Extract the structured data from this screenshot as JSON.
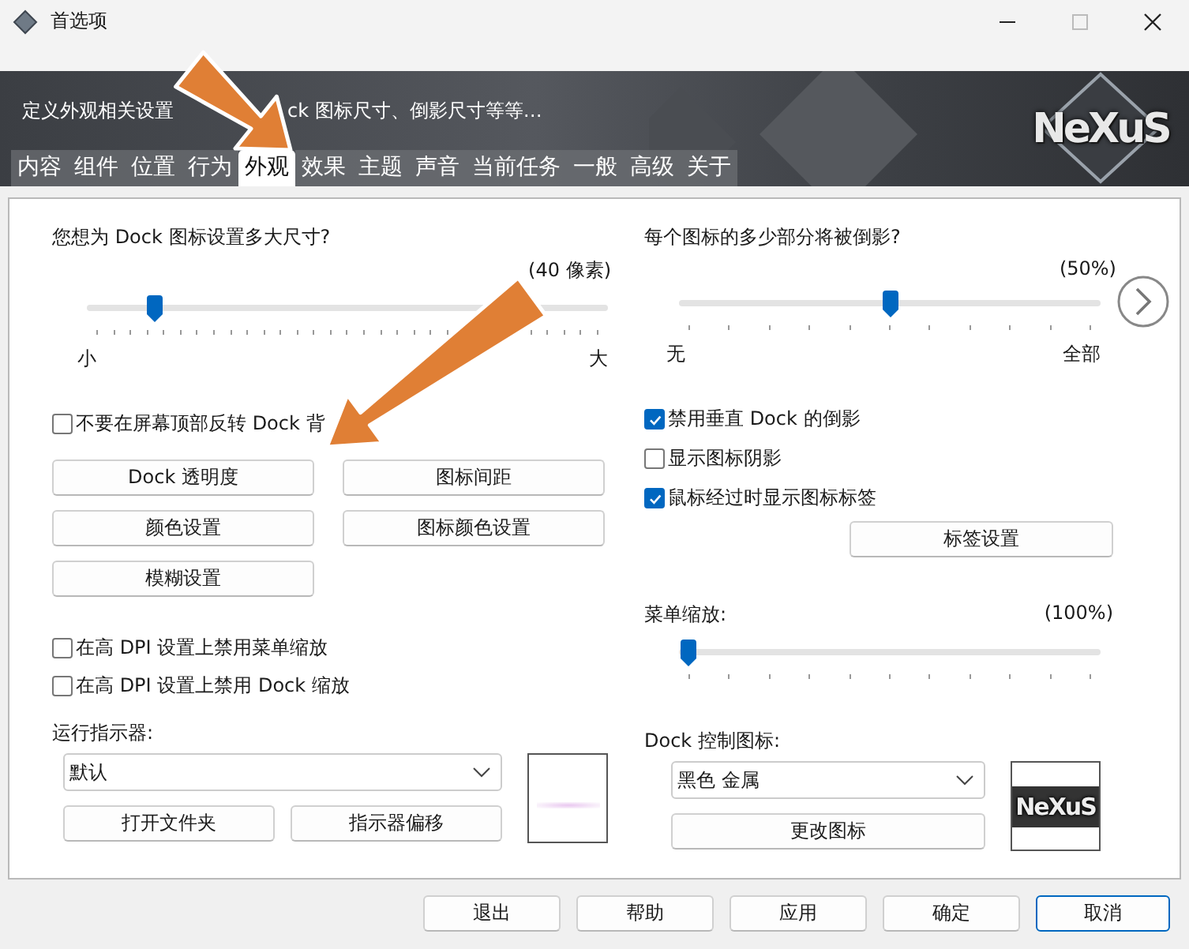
{
  "window": {
    "title": "首选项"
  },
  "header": {
    "description_parts": [
      "定义外观相关设置",
      "ck 图标尺寸、倒影尺寸等等…"
    ],
    "logo": "NeXuS"
  },
  "tabs": [
    {
      "label": "内容",
      "selected": false
    },
    {
      "label": "组件",
      "selected": false
    },
    {
      "label": "位置",
      "selected": false
    },
    {
      "label": "行为",
      "selected": false
    },
    {
      "label": "外观",
      "selected": true
    },
    {
      "label": "效果",
      "selected": false
    },
    {
      "label": "主题",
      "selected": false
    },
    {
      "label": "声音",
      "selected": false
    },
    {
      "label": "当前任务",
      "selected": false
    },
    {
      "label": "一般",
      "selected": false
    },
    {
      "label": "高级",
      "selected": false
    },
    {
      "label": "关于",
      "selected": false
    }
  ],
  "size": {
    "question": "您想为 Dock 图标设置多大尺寸?",
    "reading": "(40 像素)",
    "level": 0.115,
    "min_label": "小",
    "max_label": "大"
  },
  "flip_checkbox": {
    "label": "不要在屏幕顶部反转 Dock 背",
    "checked": false
  },
  "left_buttons": [
    "Dock 透明度",
    "图标间距",
    "颜色设置",
    "图标颜色设置",
    "模糊设置"
  ],
  "dpi_checkboxes": [
    {
      "label": "在高 DPI 设置上禁用菜单缩放",
      "checked": false
    },
    {
      "label": "在高 DPI 设置上禁用 Dock 缩放",
      "checked": false
    }
  ],
  "indicator": {
    "label": "运行指示器:",
    "value": "默认",
    "buttons": [
      "打开文件夹",
      "指示器偏移"
    ]
  },
  "reflection": {
    "question": "每个图标的多少部分将被倒影?",
    "reading": "(50%)",
    "level": 0.5,
    "min_label": "无",
    "max_label": "全部"
  },
  "right_checkboxes": [
    {
      "label": "禁用垂直 Dock 的倒影",
      "checked": true
    },
    {
      "label": "显示图标阴影",
      "checked": false
    },
    {
      "label": "鼠标经过时显示图标标签",
      "checked": true
    }
  ],
  "label_settings_button": "标签设置",
  "menu_scale": {
    "label": "菜单缩放:",
    "reading": "(100%)",
    "level": 0.0
  },
  "dock_control": {
    "label": "Dock 控制图标:",
    "value": "黑色 金属",
    "button": "更改图标",
    "logo": "NeXuS"
  },
  "footer_buttons": [
    {
      "label": "退出",
      "selected": false
    },
    {
      "label": "帮助",
      "selected": false
    },
    {
      "label": "应用",
      "selected": false
    },
    {
      "label": "确定",
      "selected": false
    },
    {
      "label": "取消",
      "selected": true
    }
  ]
}
